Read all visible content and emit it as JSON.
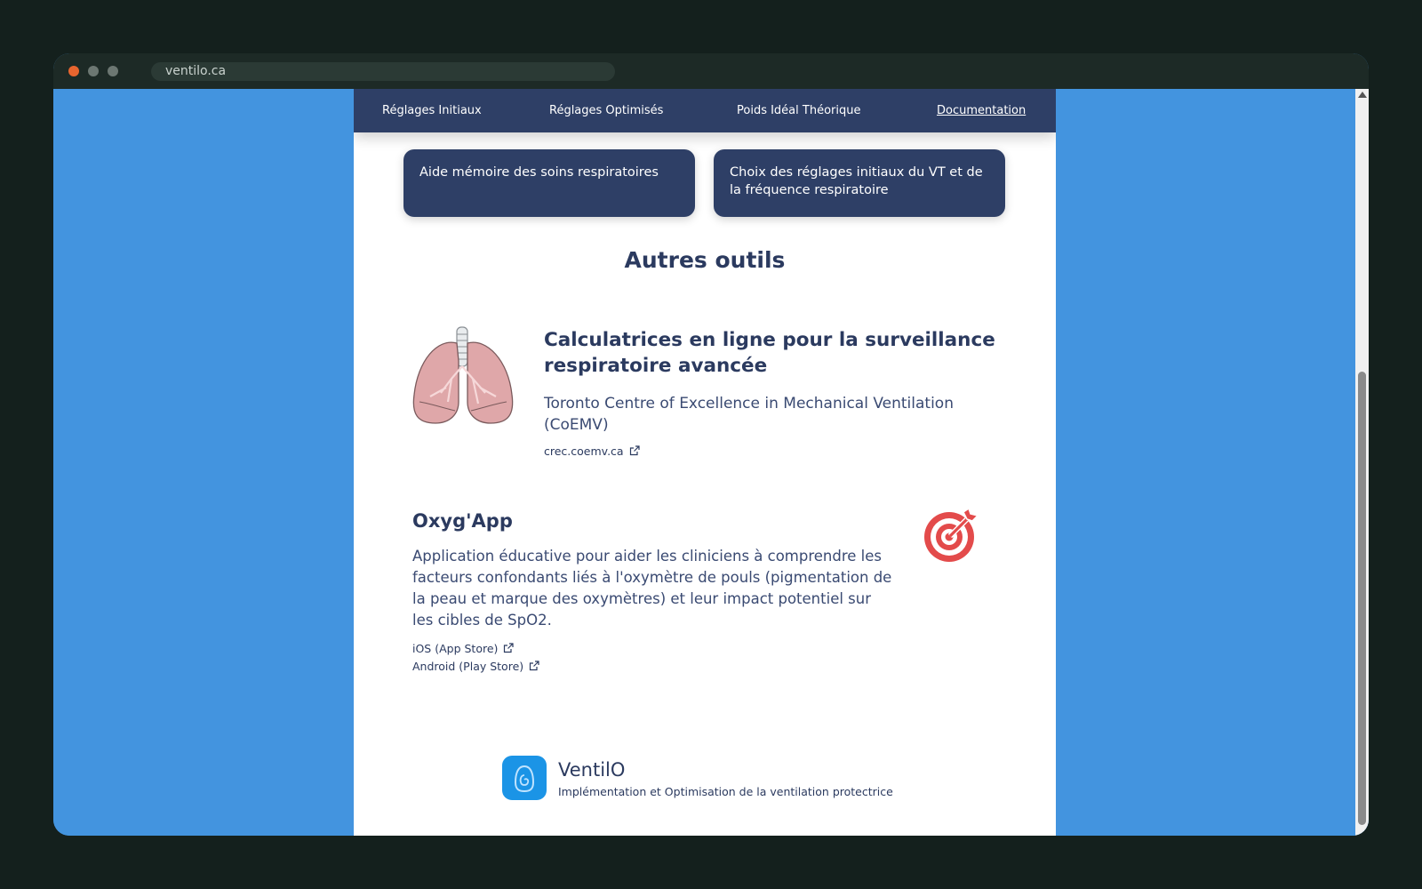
{
  "browser": {
    "url": "ventilo.ca"
  },
  "nav": {
    "items": [
      {
        "label": "Réglages Initiaux"
      },
      {
        "label": "Réglages Optimisés"
      },
      {
        "label": "Poids Idéal Théorique"
      },
      {
        "label": "Documentation",
        "active": true
      }
    ]
  },
  "doc_cards": [
    {
      "label": "Aide mémoire des soins respiratoires"
    },
    {
      "label": "Choix des réglages initiaux du VT et de la fréquence respiratoire"
    }
  ],
  "section": {
    "title": "Autres outils"
  },
  "tools": [
    {
      "title": "Calculatrices en ligne pour la surveillance respiratoire avancée",
      "org": "Toronto Centre of Excellence in Mechanical Ventilation (CoEMV)",
      "icon": "lungs-illustration",
      "links": [
        {
          "label": "crec.coemv.ca"
        }
      ]
    },
    {
      "title": "Oxyg'App",
      "description": "Application éducative pour aider les cliniciens à comprendre les facteurs confondants liés à l'oxymètre de pouls (pigmentation de la peau et marque des oxymètres) et leur impact potentiel sur les cibles de SpO2.",
      "icon": "target-icon",
      "links": [
        {
          "label": "iOS (App Store)"
        },
        {
          "label": "Android (Play Store)"
        }
      ]
    }
  ],
  "footer": {
    "name": "VentilO",
    "tagline": "Implémentation et Optimisation de la ventilation protectrice"
  },
  "colors": {
    "background": "#4394df",
    "nav": "#2e3f66",
    "text": "#2b3a5f",
    "target_red": "#e34b4b",
    "logo_blue": "#1b94e6"
  }
}
